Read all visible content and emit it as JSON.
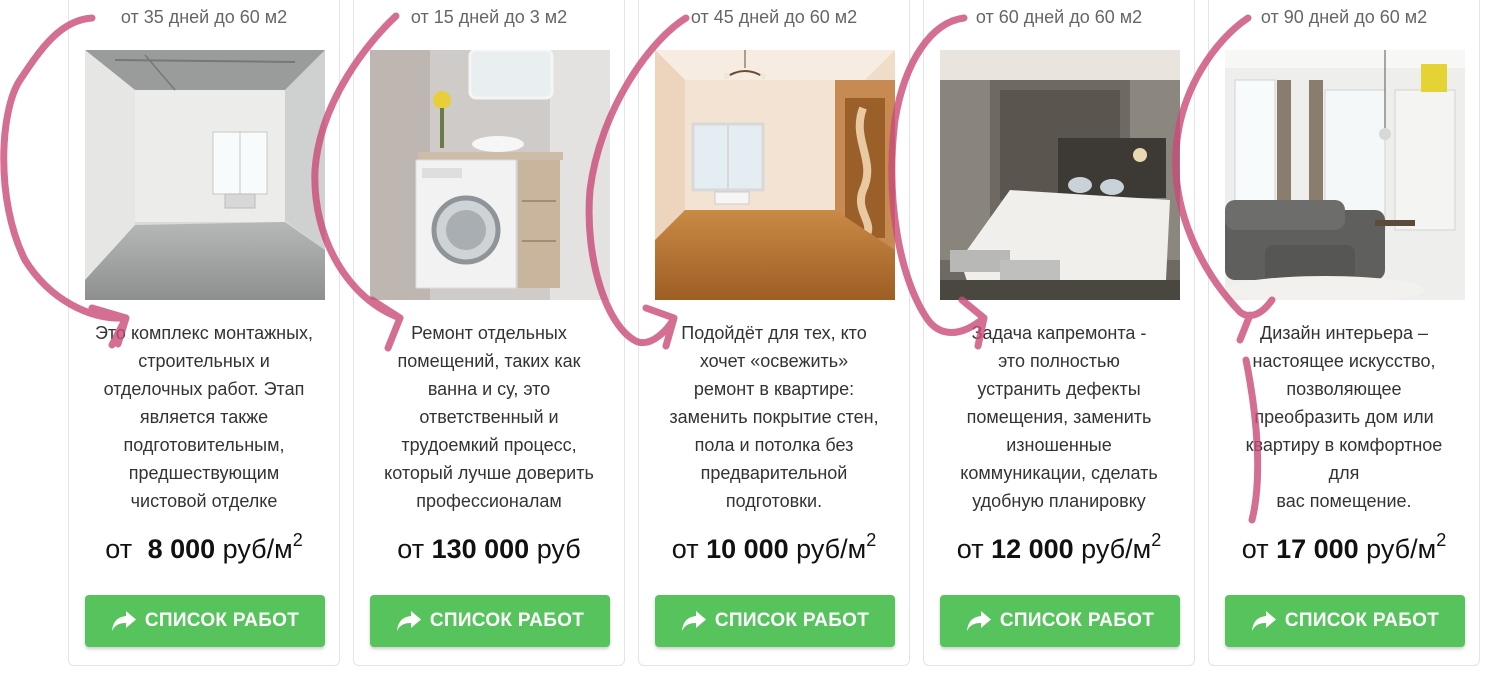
{
  "cards": [
    {
      "term": "от 35 дней до 60 м2",
      "image": "empty-room-concrete-photo",
      "description_lines": [
        "Это комплекс монтажных,",
        "строительных и",
        "отделочных работ. Этап",
        "является также",
        "подготовительным,",
        "предшествующим",
        "чистовой отделке"
      ],
      "price_prefix": "от ",
      "price_amount": "8 000",
      "price_unit": " руб/м",
      "price_sup": "2",
      "button_label": "СПИСОК РАБОТ",
      "button_icon": "share-arrow-icon"
    },
    {
      "term": "от 15 дней до 3 м2",
      "image": "bathroom-washing-machine-photo",
      "description_lines": [
        "Ремонт отдельных",
        "помещений, таких как",
        "ванна и су, это",
        "ответственный и",
        "трудоемкий процесс,",
        "который лучше доверить",
        "профессионалам"
      ],
      "price_prefix": "от ",
      "price_amount": "130 000",
      "price_unit": " руб",
      "price_sup": "",
      "button_label": "СПИСОК РАБОТ",
      "button_icon": "share-arrow-icon"
    },
    {
      "term": "от 45 дней до 60 м2",
      "image": "room-with-chandelier-photo",
      "description_lines": [
        "Подойдёт для тех, кто",
        "хочет «освежить»",
        "ремонт в квартире:",
        "заменить покрытие стен,",
        "пола и потолка без",
        "предварительной",
        "подготовки."
      ],
      "price_prefix": "от ",
      "price_amount": "10 000",
      "price_unit": " руб/м",
      "price_sup": "2",
      "button_label": "СПИСОК РАБОТ",
      "button_icon": "share-arrow-icon"
    },
    {
      "term": "от 60 дней до 60 м2",
      "image": "bedroom-photo",
      "description_lines": [
        "Задача капремонта  -",
        "это полностью",
        "устранить дефекты",
        "помещения, заменить",
        "изношенные",
        "коммуникации, сделать",
        "удобную планировку"
      ],
      "price_prefix": "от ",
      "price_amount": "12 000",
      "price_unit": " руб/м",
      "price_sup": "2",
      "button_label": "СПИСОК РАБОТ",
      "button_icon": "share-arrow-icon"
    },
    {
      "term": "от 90 дней до 60 м2",
      "image": "living-room-design-photo",
      "description_lines": [
        "Дизайн интерьера –",
        "настоящее искусство,",
        "позволяющее",
        "преобразить дом или",
        "квартиру в комфортное",
        "для",
        "вас помещение."
      ],
      "price_prefix": "от ",
      "price_amount": "17 000",
      "price_unit": " руб/м",
      "price_sup": "2",
      "button_label": "СПИСОК РАБОТ",
      "button_icon": "share-arrow-icon"
    }
  ],
  "colors": {
    "button_green": "#57c35c",
    "annotation_pink": "#c94a78",
    "text": "#333333",
    "term_text": "#666666"
  }
}
